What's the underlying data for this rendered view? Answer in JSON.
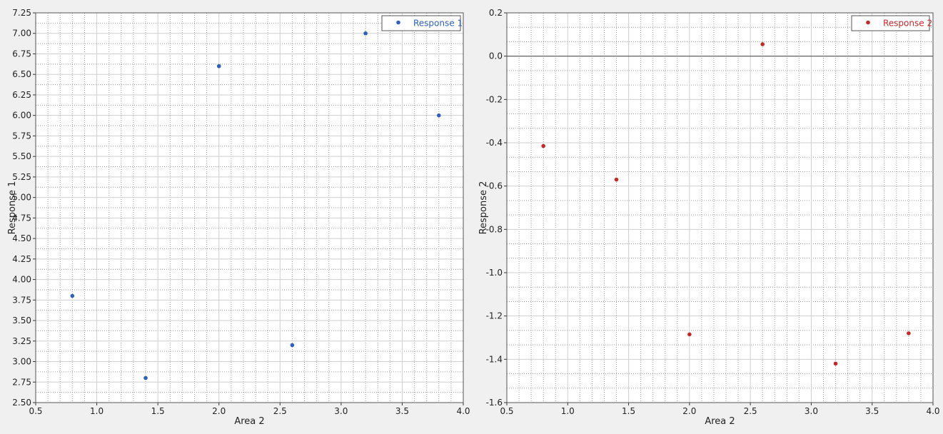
{
  "chart_data": [
    {
      "type": "scatter",
      "xlabel": "Area 2",
      "ylabel": "Response 1",
      "xlim": [
        0.5,
        4.0
      ],
      "ylim": [
        2.5,
        7.25
      ],
      "x_ticks": [
        "0.5",
        "1.0",
        "1.5",
        "2.0",
        "2.5",
        "3.0",
        "3.5",
        "4.0"
      ],
      "y_ticks": [
        "2.50",
        "2.75",
        "3.00",
        "3.25",
        "3.50",
        "3.75",
        "4.00",
        "4.25",
        "4.50",
        "4.75",
        "5.00",
        "5.25",
        "5.50",
        "5.75",
        "6.00",
        "6.25",
        "6.50",
        "6.75",
        "7.00",
        "7.25"
      ],
      "grid": true,
      "legend_position": "top-right",
      "series": [
        {
          "name": "Response 1",
          "color": "#2e5fbf",
          "points": [
            {
              "x": 0.8,
              "y": 3.8
            },
            {
              "x": 1.4,
              "y": 2.8
            },
            {
              "x": 2.0,
              "y": 6.6
            },
            {
              "x": 2.6,
              "y": 3.2
            },
            {
              "x": 3.2,
              "y": 7.0
            },
            {
              "x": 3.8,
              "y": 6.0
            }
          ]
        }
      ]
    },
    {
      "type": "scatter",
      "xlabel": "Area 2",
      "ylabel": "Response 2",
      "xlim": [
        0.5,
        4.0
      ],
      "ylim": [
        -1.6,
        0.2
      ],
      "x_ticks": [
        "0.5",
        "1.0",
        "1.5",
        "2.0",
        "2.5",
        "3.0",
        "3.5",
        "4.0"
      ],
      "y_ticks": [
        "-1.6",
        "-1.4",
        "-1.2",
        "-1.0",
        "-0.8",
        "-0.6",
        "-0.4",
        "-0.2",
        "0.0",
        "0.2"
      ],
      "grid": true,
      "legend_position": "top-right",
      "zero_line": true,
      "series": [
        {
          "name": "Response 2",
          "color": "#c62828",
          "points": [
            {
              "x": 0.8,
              "y": -0.415
            },
            {
              "x": 1.4,
              "y": -0.57
            },
            {
              "x": 2.0,
              "y": -1.285
            },
            {
              "x": 2.6,
              "y": 0.055
            },
            {
              "x": 3.2,
              "y": -1.42
            },
            {
              "x": 3.8,
              "y": -1.28
            }
          ]
        }
      ]
    }
  ]
}
